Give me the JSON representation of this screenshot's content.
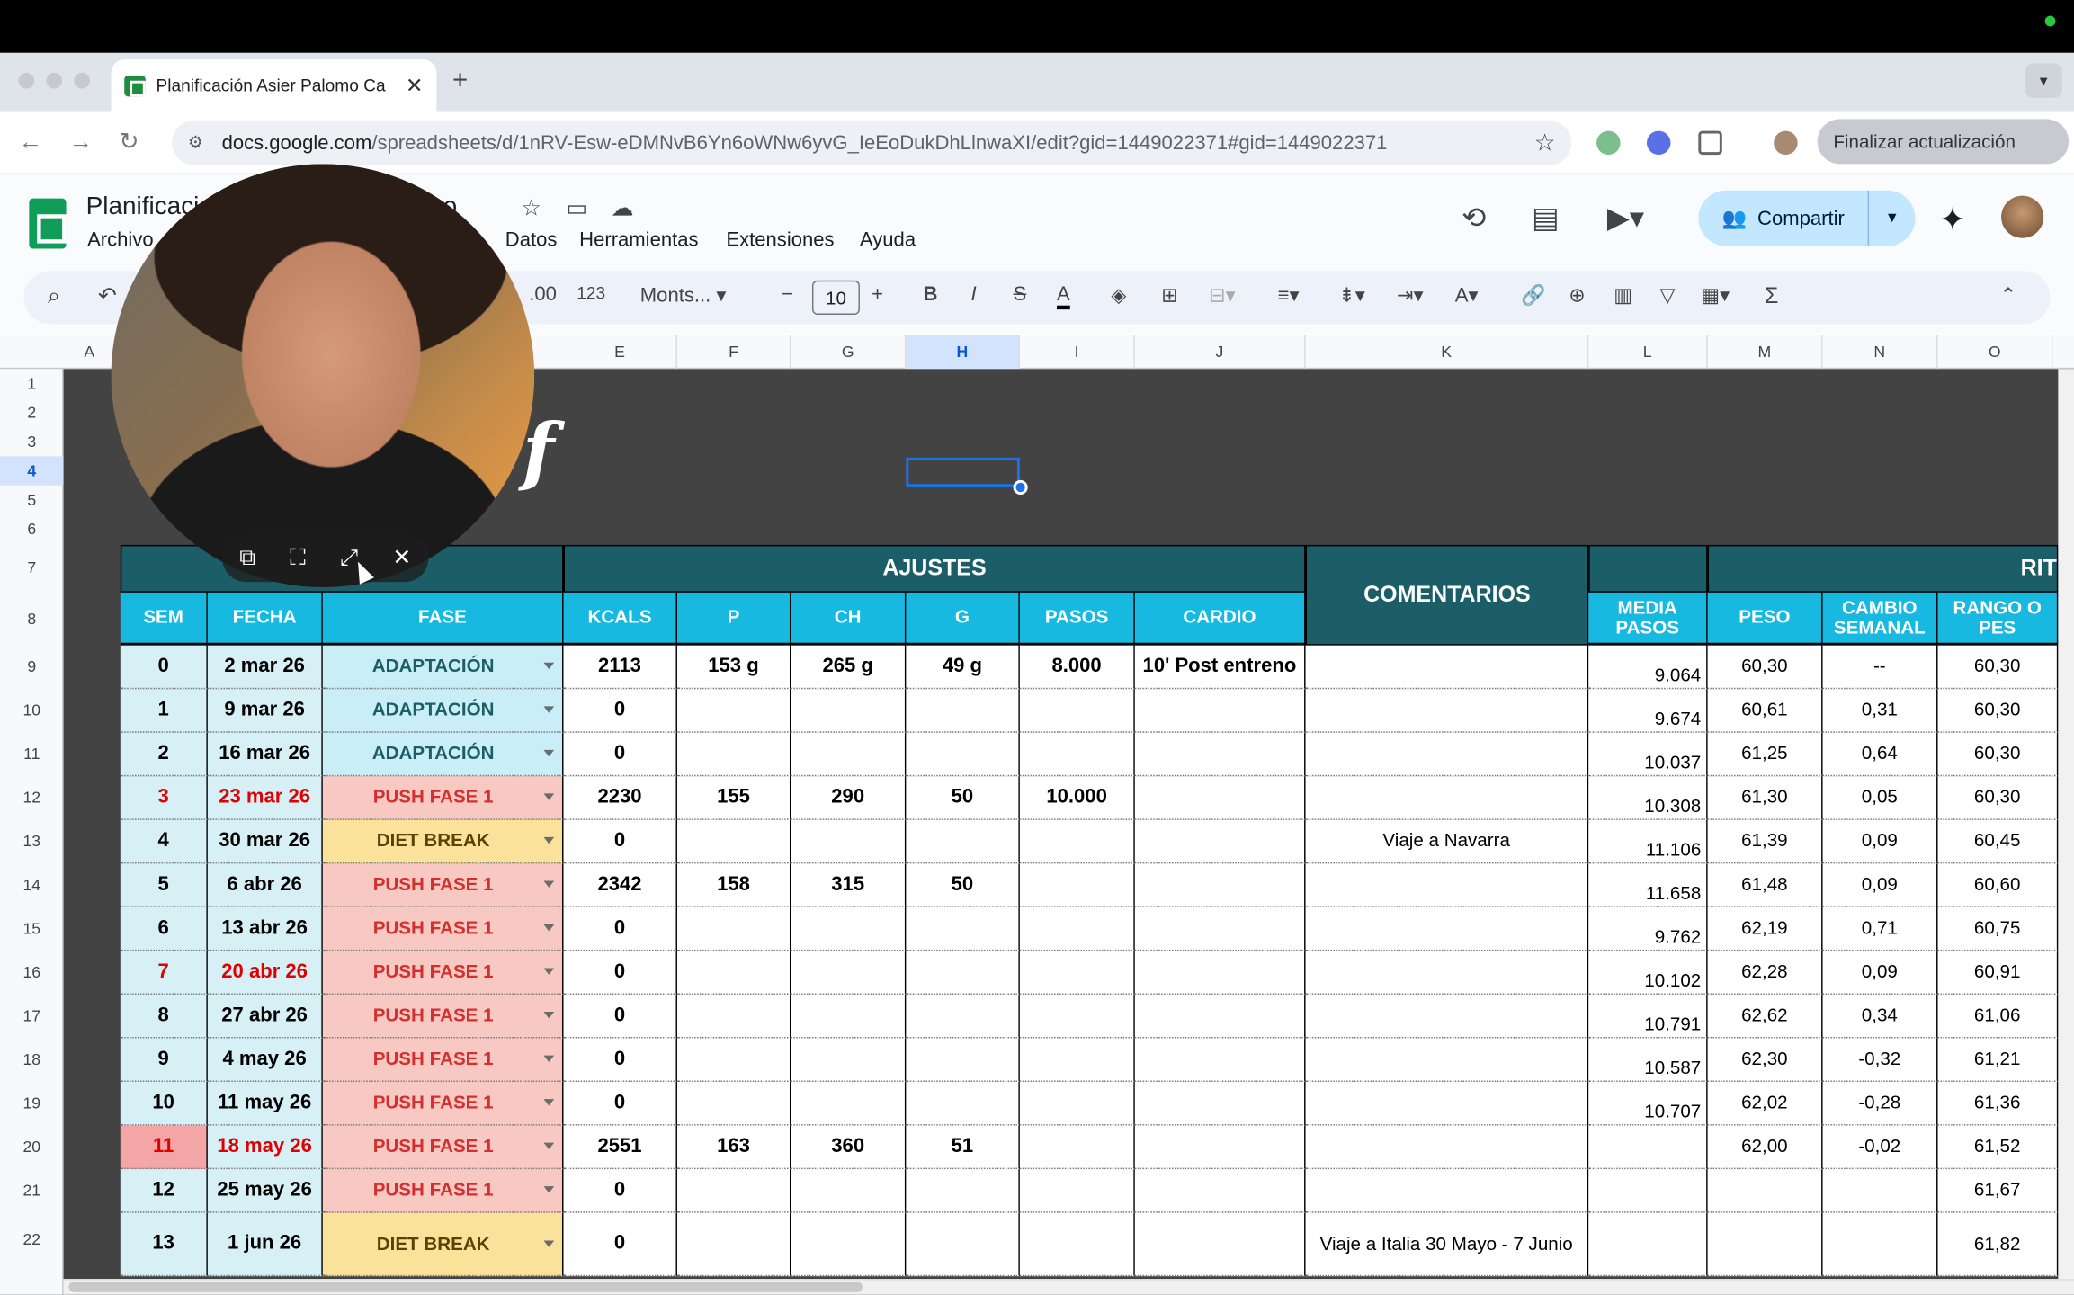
{
  "browser": {
    "tab_title": "Planificación Asier Palomo Ca",
    "tab_close": "✕",
    "new_tab": "+",
    "url_host": "docs.google.com",
    "url_path": "/spreadsheets/d/1nRV-Esw-eDMNvB6Yn6oWNw6yvG_IeEoDukDhLlnwaXI/edit?gid=1449022371#gid=1449022371",
    "update_button": "Finalizar actualización",
    "back": "←",
    "forward": "→",
    "reload": "↻",
    "star": "☆",
    "menu": "⋮"
  },
  "sheets": {
    "title_a": "Planificaci",
    "title_b": "sco",
    "menu": {
      "file": "Archivo",
      "data": "Datos",
      "tools": "Herramientas",
      "extensions": "Extensiones",
      "help": "Ayuda"
    },
    "share": "Compartir",
    "toolbar": {
      "decimal": ".00",
      "format": "123",
      "font": "Monts...",
      "font_size": "10",
      "minus": "−",
      "plus": "+",
      "bold": "B",
      "italic": "I",
      "strike": "S",
      "text_color": "A",
      "sigma": "Σ",
      "collapse": "⌃",
      "search": "⌕",
      "undo": "↶"
    }
  },
  "columns": [
    "A",
    "E",
    "F",
    "G",
    "H",
    "I",
    "J",
    "K",
    "L",
    "M",
    "N",
    "O"
  ],
  "rows": [
    "1",
    "2",
    "3",
    "4",
    "5",
    "6",
    "7",
    "8",
    "9",
    "10",
    "11",
    "12",
    "13",
    "14",
    "15",
    "16",
    "17",
    "18",
    "19",
    "20",
    "21",
    "22"
  ],
  "brand_text": "f",
  "headers": {
    "ajustes": "AJUSTES",
    "comentarios": "COMENTARIOS",
    "rit": "RIT",
    "sem": "SEM",
    "fecha": "FECHA",
    "fase": "FASE",
    "kcals": "KCALS",
    "p": "P",
    "ch": "CH",
    "g": "G",
    "pasos": "PASOS",
    "cardio": "CARDIO",
    "media_pasos": "MEDIA PASOS",
    "peso": "PESO",
    "cambio_semanal": "CAMBIO SEMANAL",
    "rango": "RANGO O PES"
  },
  "table": [
    {
      "sem": "0",
      "fecha": "2 mar 26",
      "fase": "ADAPTACIÓN",
      "kcals": "2113",
      "p": "153 g",
      "ch": "265 g",
      "g": "49 g",
      "pasos": "8.000",
      "cardio": "10' Post entreno",
      "com": "",
      "media": "9.064",
      "peso": "60,30",
      "cambio": "--",
      "rango": "60,30"
    },
    {
      "sem": "1",
      "fecha": "9 mar 26",
      "fase": "ADAPTACIÓN",
      "kcals": "0",
      "p": "",
      "ch": "",
      "g": "",
      "pasos": "",
      "cardio": "",
      "com": "",
      "media": "9.674",
      "peso": "60,61",
      "cambio": "0,31",
      "rango": "60,30"
    },
    {
      "sem": "2",
      "fecha": "16 mar 26",
      "fase": "ADAPTACIÓN",
      "kcals": "0",
      "p": "",
      "ch": "",
      "g": "",
      "pasos": "",
      "cardio": "",
      "com": "",
      "media": "10.037",
      "peso": "61,25",
      "cambio": "0,64",
      "rango": "60,30"
    },
    {
      "sem": "3",
      "fecha": "23 mar 26",
      "fase": "PUSH FASE 1",
      "kcals": "2230",
      "p": "155",
      "ch": "290",
      "g": "50",
      "pasos": "10.000",
      "cardio": "",
      "com": "",
      "media": "10.308",
      "peso": "61,30",
      "cambio": "0,05",
      "rango": "60,30"
    },
    {
      "sem": "4",
      "fecha": "30 mar 26",
      "fase": "DIET BREAK",
      "kcals": "0",
      "p": "",
      "ch": "",
      "g": "",
      "pasos": "",
      "cardio": "",
      "com": "Viaje a Navarra",
      "media": "11.106",
      "peso": "61,39",
      "cambio": "0,09",
      "rango": "60,45"
    },
    {
      "sem": "5",
      "fecha": "6 abr 26",
      "fase": "PUSH FASE 1",
      "kcals": "2342",
      "p": "158",
      "ch": "315",
      "g": "50",
      "pasos": "",
      "cardio": "",
      "com": "",
      "media": "11.658",
      "peso": "61,48",
      "cambio": "0,09",
      "rango": "60,60"
    },
    {
      "sem": "6",
      "fecha": "13 abr 26",
      "fase": "PUSH FASE 1",
      "kcals": "0",
      "p": "",
      "ch": "",
      "g": "",
      "pasos": "",
      "cardio": "",
      "com": "",
      "media": "9.762",
      "peso": "62,19",
      "cambio": "0,71",
      "rango": "60,75"
    },
    {
      "sem": "7",
      "fecha": "20 abr 26",
      "fase": "PUSH FASE 1",
      "kcals": "0",
      "p": "",
      "ch": "",
      "g": "",
      "pasos": "",
      "cardio": "",
      "com": "",
      "media": "10.102",
      "peso": "62,28",
      "cambio": "0,09",
      "rango": "60,91"
    },
    {
      "sem": "8",
      "fecha": "27 abr 26",
      "fase": "PUSH FASE 1",
      "kcals": "0",
      "p": "",
      "ch": "",
      "g": "",
      "pasos": "",
      "cardio": "",
      "com": "",
      "media": "10.791",
      "peso": "62,62",
      "cambio": "0,34",
      "rango": "61,06"
    },
    {
      "sem": "9",
      "fecha": "4 may 26",
      "fase": "PUSH FASE 1",
      "kcals": "0",
      "p": "",
      "ch": "",
      "g": "",
      "pasos": "",
      "cardio": "",
      "com": "",
      "media": "10.587",
      "peso": "62,30",
      "cambio": "-0,32",
      "rango": "61,21"
    },
    {
      "sem": "10",
      "fecha": "11 may 26",
      "fase": "PUSH FASE 1",
      "kcals": "0",
      "p": "",
      "ch": "",
      "g": "",
      "pasos": "",
      "cardio": "",
      "com": "",
      "media": "10.707",
      "peso": "62,02",
      "cambio": "-0,28",
      "rango": "61,36"
    },
    {
      "sem": "11",
      "fecha": "18 may 26",
      "fase": "PUSH FASE 1",
      "kcals": "2551",
      "p": "163",
      "ch": "360",
      "g": "51",
      "pasos": "",
      "cardio": "",
      "com": "",
      "media": "",
      "peso": "62,00",
      "cambio": "-0,02",
      "rango": "61,52"
    },
    {
      "sem": "12",
      "fecha": "25 may 26",
      "fase": "PUSH FASE 1",
      "kcals": "0",
      "p": "",
      "ch": "",
      "g": "",
      "pasos": "",
      "cardio": "",
      "com": "",
      "media": "",
      "peso": "",
      "cambio": "",
      "rango": "61,67"
    },
    {
      "sem": "13",
      "fecha": "1 jun 26",
      "fase": "DIET BREAK",
      "kcals": "0",
      "p": "",
      "ch": "",
      "g": "",
      "pasos": "",
      "cardio": "",
      "com": "Viaje a Italia 30 Mayo - 7 Junio",
      "media": "",
      "peso": "",
      "cambio": "",
      "rango": "61,82"
    }
  ],
  "pip": {
    "open": "⧉",
    "capture": "⛶",
    "expand": "⤢",
    "close": "✕"
  }
}
